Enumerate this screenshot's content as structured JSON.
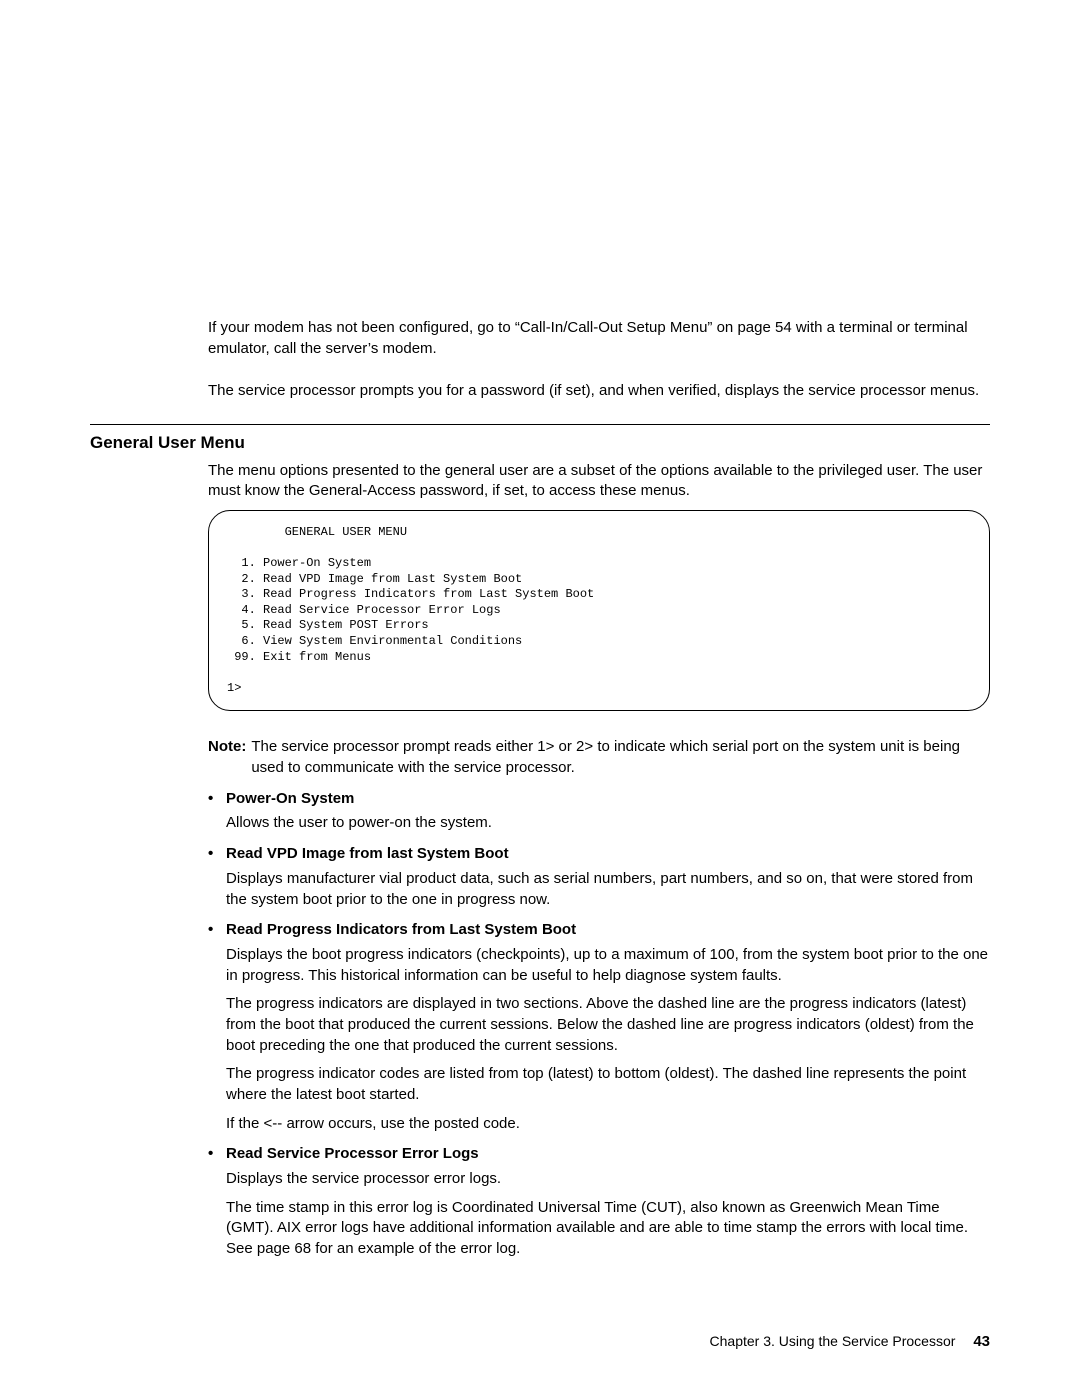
{
  "intro": {
    "p1": "If your modem has not been configured, go to “Call-In/Call-Out Setup Menu” on page 54 with a terminal or terminal emulator, call the server’s modem.",
    "p2": "The service processor prompts you for a password (if set), and when verified, displays the service processor menus."
  },
  "section_title": "General User Menu",
  "section_intro": "The menu options presented to the general user are a subset of the options available to the privileged user. The user must know the General-Access password, if set, to access these menus.",
  "menu_box": "        GENERAL USER MENU\n\n  1. Power-On System\n  2. Read VPD Image from Last System Boot\n  3. Read Progress Indicators from Last System Boot\n  4. Read Service Processor Error Logs\n  5. Read System POST Errors\n  6. View System Environmental Conditions\n 99. Exit from Menus\n\n1>",
  "note": {
    "label": "Note:",
    "text": "The service processor prompt reads either 1> or 2> to indicate which serial port on the system unit is being used to communicate with the service processor."
  },
  "bullets": [
    {
      "title": "Power-On System",
      "paras": [
        "Allows the user to power-on the system."
      ]
    },
    {
      "title": "Read VPD Image from last System Boot",
      "paras": [
        "Displays manufacturer vial product data, such as serial numbers, part numbers, and so on, that were stored from the system boot prior to the one in progress now."
      ]
    },
    {
      "title": "Read Progress Indicators from Last System Boot",
      "paras": [
        "Displays the boot progress indicators (checkpoints), up to a maximum of 100, from the system boot prior to the one in progress. This historical information can be useful to help diagnose system faults.",
        "The progress indicators are displayed in two sections. Above the dashed line are the progress indicators (latest) from the boot that produced the current sessions. Below the dashed line are progress indicators (oldest) from the boot preceding the one that produced the current sessions.",
        "The progress indicator codes are listed from top (latest) to bottom (oldest). The dashed line represents the point where the latest boot started.",
        "If the <-- arrow occurs, use the posted code."
      ]
    },
    {
      "title": "Read Service Processor Error Logs",
      "paras": [
        "Displays the service processor error logs.",
        "The time stamp in this error log is Coordinated Universal Time (CUT), also known as Greenwich Mean Time (GMT). AIX error logs have additional information available and are able to time stamp the errors with local time. See page 68 for an example of the error log."
      ]
    }
  ],
  "footer": {
    "chapter": "Chapter 3. Using the Service Processor",
    "page": "43"
  }
}
